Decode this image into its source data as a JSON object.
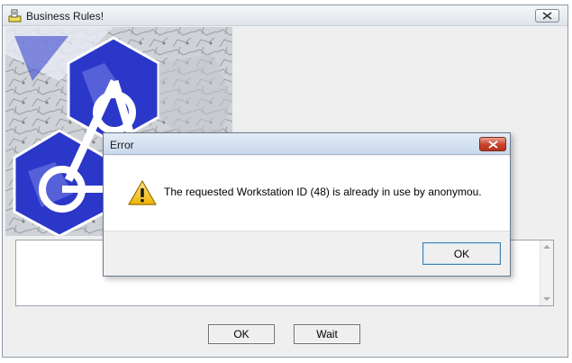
{
  "window": {
    "title": "Business Rules!"
  },
  "main": {
    "details_text": "",
    "ok_label": "OK",
    "wait_label": "Wait"
  },
  "dialog": {
    "title": "Error",
    "message": "The requested Workstation ID (48) is already in use by anonymou.",
    "ok_label": "OK",
    "icon": "warning-icon"
  },
  "colors": {
    "dialog_close": "#c9412b",
    "warning": "#f4c21b",
    "logo_blue": "#2b37c8"
  }
}
